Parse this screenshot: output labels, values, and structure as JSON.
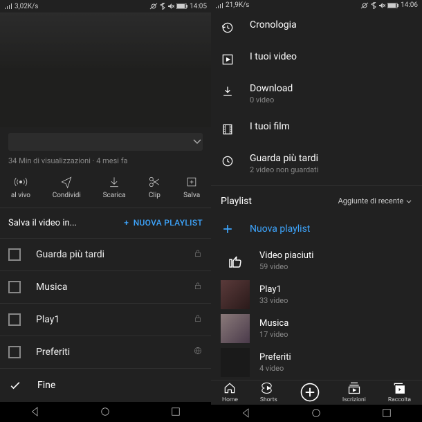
{
  "left": {
    "status": {
      "net": "3,02K/s",
      "time": "14:05"
    },
    "video_meta": "34 Min di visualizzazioni · 4 mesi fa",
    "actions": {
      "a0": "al vivo",
      "a1": "Condividi",
      "a2": "Scarica",
      "a3": "Clip",
      "a4": "Salva"
    },
    "sheet": {
      "title": "Salva il video in...",
      "new_label": "NUOVA PLAYLIST",
      "rows": {
        "r0": "Guarda più tardi",
        "r1": "Musica",
        "r2": "Play1",
        "r3": "Preferiti"
      },
      "done": "Fine"
    }
  },
  "right": {
    "status": {
      "net": "21,9K/s",
      "time": "14:06"
    },
    "lib": {
      "history": "Cronologia",
      "yourvideos": "I tuoi video",
      "downloads": "Download",
      "downloads_sub": "0 video",
      "movies": "I tuoi film",
      "watchlater": "Guarda più tardi",
      "watchlater_sub": "2 video non guardati"
    },
    "section": {
      "title": "Playlist",
      "sort": "Aggiunte di recente"
    },
    "new_playlist": "Nuova playlist",
    "playlists": {
      "p0_t": "Video piaciuti",
      "p0_s": "59 video",
      "p1_t": "Play1",
      "p1_s": "33 video",
      "p2_t": "Musica",
      "p2_s": "17 video",
      "p3_t": "Preferiti",
      "p3_s": "4 video"
    },
    "nav": {
      "home": "Home",
      "shorts": "Shorts",
      "subs": "Iscrizioni",
      "library": "Raccolta"
    }
  }
}
